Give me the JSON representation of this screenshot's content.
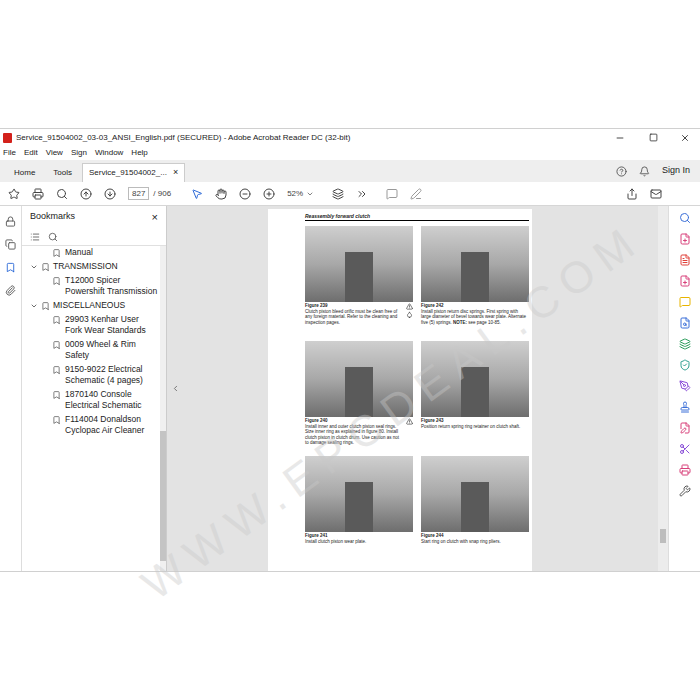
{
  "window": {
    "title": "Service_91504002_03-03_ANSI_English.pdf (SECURED) - Adobe Acrobat Reader DC (32-bit)"
  },
  "menu": [
    "File",
    "Edit",
    "View",
    "Sign",
    "Window",
    "Help"
  ],
  "tabs": [
    {
      "label": "Home",
      "selected": false
    },
    {
      "label": "Tools",
      "selected": false
    },
    {
      "label": "Service_91504002_...",
      "selected": true,
      "close": "×"
    }
  ],
  "account": {
    "sign_in": "Sign In"
  },
  "toolbar": {
    "page": "827",
    "page_count": "/ 906",
    "zoom": "52%"
  },
  "bookmarks": {
    "title": "Bookmarks",
    "close": "×",
    "items": [
      {
        "label": "Manual",
        "kind": "item",
        "expanded": false
      },
      {
        "label": "TRANSMISSION",
        "kind": "group",
        "expanded": true
      },
      {
        "label": "T12000 Spicer Powershift Transmission",
        "kind": "item",
        "expanded": false
      },
      {
        "label": "MISCELLANEOUS",
        "kind": "group",
        "expanded": true
      },
      {
        "label": "29903 Kenhar User Fork Wear Standards",
        "kind": "item",
        "expanded": false
      },
      {
        "label": "0009 Wheel & Rim Safety",
        "kind": "item",
        "expanded": false
      },
      {
        "label": "9150-9022 Electrical Schematic (4 pages)",
        "kind": "item",
        "expanded": false
      },
      {
        "label": "1870140 Console Electrical Schematic",
        "kind": "item",
        "expanded": false
      },
      {
        "label": "F114004 Donaldson Cyclopac Air Cleaner",
        "kind": "item",
        "expanded": false
      }
    ]
  },
  "page": {
    "heading": "Reassembly forward clutch",
    "figures": [
      {
        "label": "Figure 239",
        "caption": "Clutch piston bleed orific must be clean free of any foreign material. Refer to the cleaning and inspection pages.",
        "note_label": "",
        "note": "",
        "icons": 2
      },
      {
        "label": "Figure 242",
        "caption": "Install piston return disc springs. First spring with large diameter of bevel towards wear plate. Alternate five (5) springs.",
        "note_label": "NOTE:",
        "note": "see page 10-85.",
        "icons": 0
      },
      {
        "label": "Figure 240",
        "caption": "Install inner and outer clutch piston seal rings. Size inner ring as explained in figure 80. Install clutch piston in clutch drum. Use caution as not to damage sealing rings.",
        "note_label": "",
        "note": "",
        "icons": 1
      },
      {
        "label": "Figure 243",
        "caption": "Position return spring ring retainer on clutch shaft.",
        "note_label": "",
        "note": "",
        "icons": 0
      },
      {
        "label": "Figure 241",
        "caption": "Install clutch piston wear plate.",
        "note_label": "",
        "note": "",
        "icons": 0
      },
      {
        "label": "Figure 244",
        "caption": "Start ring on clutch with snap ring pliers.",
        "note_label": "",
        "note": "",
        "icons": 0
      }
    ]
  },
  "watermark": "WWW.EPCDEAL.COM"
}
